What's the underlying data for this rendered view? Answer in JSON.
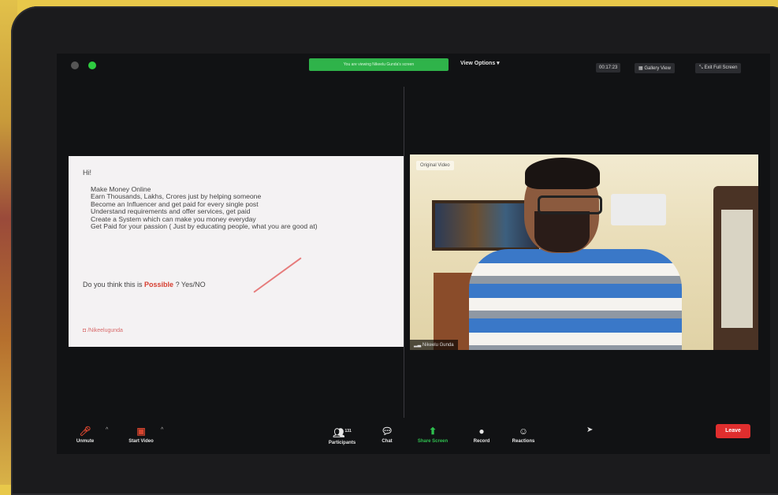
{
  "topbar": {
    "share_banner": "You are viewing Nikeelu Gunda's screen",
    "view_options": "View Options ▾",
    "timer": "00:17:23",
    "gallery_view": "Gallery View",
    "exit_full_screen": "Exit Full Screen"
  },
  "slide": {
    "greeting": "Hi!",
    "bullets": [
      "Make Money Online",
      "Earn Thousands, Lakhs, Crores just by helping someone",
      "Become an Influencer and get paid for every single post",
      "Understand requirements and offer services, get paid",
      "Create a System which can make you money everyday",
      "Get Paid for your passion ( Just by educating people, what you are good at)"
    ],
    "question_prefix": "Do you think this is ",
    "question_highlight": "Possible",
    "question_suffix": " ? Yes/NO",
    "handle": "/Nikeelugunda"
  },
  "video": {
    "top_label": "Original Video",
    "participant_name": "Nikeelu Gunda"
  },
  "toolbar": {
    "unmute": "Unmute",
    "start_video": "Start Video",
    "participants": "Participants",
    "participants_count": "131",
    "chat": "Chat",
    "share_screen": "Share Screen",
    "record": "Record",
    "reactions": "Reactions",
    "leave": "Leave"
  },
  "colors": {
    "share_banner": "#2fb34a",
    "leave": "#e02e2e",
    "possible": "#d63d2f"
  }
}
